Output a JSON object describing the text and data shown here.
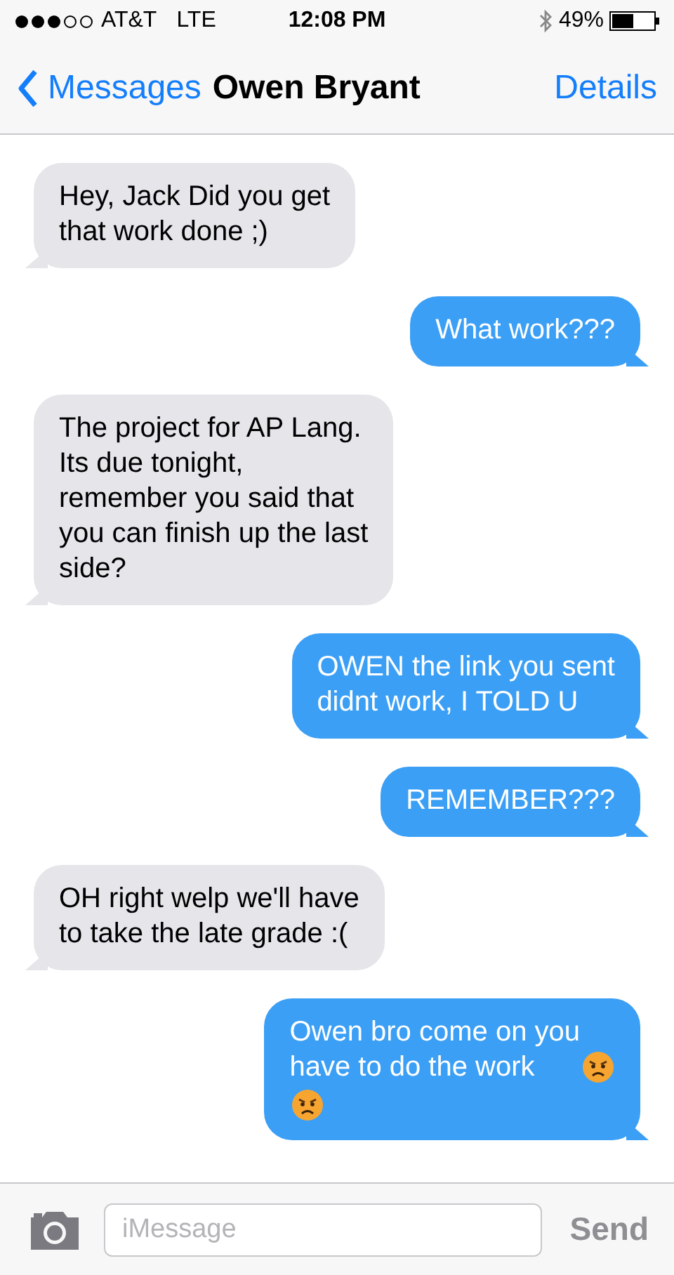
{
  "status_bar": {
    "carrier": "AT&T",
    "network": "LTE",
    "time": "12:08 PM",
    "battery": "49%"
  },
  "nav": {
    "back": "Messages",
    "title": "Owen Bryant",
    "action": "Details"
  },
  "messages": [
    {
      "kind": "incoming",
      "text": "Hey, Jack Did you get\nthat work done ;)"
    },
    {
      "kind": "outgoing",
      "text": "What work???"
    },
    {
      "kind": "incoming",
      "text": "The project for AP Lang.\nIts due tonight,\nremember you said that\nyou can finish up the last\nside?"
    },
    {
      "kind": "outgoing",
      "text": "OWEN the link you sent\ndidnt work, I TOLD U"
    },
    {
      "kind": "outgoing",
      "text": "REMEMBER???"
    },
    {
      "kind": "incoming",
      "text": "OH right welp we'll have\nto take the late grade :("
    },
    {
      "kind": "outgoing",
      "text": "Owen bro come on you\nhave to do the work",
      "icons": [
        {
          "kind": "angry-face"
        },
        {
          "kind": "angry-face"
        }
      ]
    }
  ],
  "composer": {
    "placeholder": "iMessage",
    "send": "Send"
  }
}
